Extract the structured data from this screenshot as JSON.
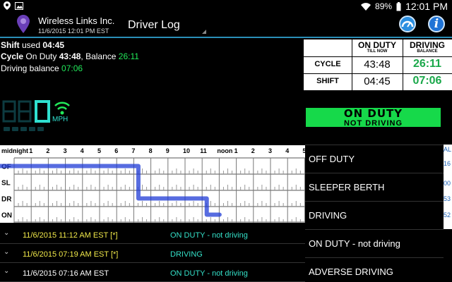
{
  "status_bar": {
    "battery": "89%",
    "time": "12:01 PM"
  },
  "header": {
    "company": "Wireless Links Inc.",
    "datetime": "11/6/2015 12:01 PM EST",
    "title": "Driver Log"
  },
  "summary": {
    "shift_label": "Shift",
    "shift_mid": " used ",
    "shift_used": "04:45",
    "cycle_label": "Cycle",
    "cycle_mid": " On Duty ",
    "cycle_on_duty": "43:48",
    "balance_label": ", Balance ",
    "cycle_balance": "26:11",
    "driving_label": "Driving balance ",
    "driving_balance": "07:06"
  },
  "hours_table": {
    "col1_title": "ON DUTY",
    "col1_sub": "TILL NOW",
    "col2_title": "DRIVING",
    "col2_sub": "BALANCE",
    "rows": [
      {
        "label": "CYCLE",
        "on_duty": "43:48",
        "driving": "26:11"
      },
      {
        "label": "SHIFT",
        "on_duty": "04:45",
        "driving": "07:06"
      }
    ]
  },
  "speedometer": {
    "value": "0",
    "unit": "MPH"
  },
  "duty_status": {
    "line1": "ON DUTY",
    "line2": "NOT DRIVING",
    "color": "#16d94a"
  },
  "chart_data": {
    "type": "line",
    "hour_labels": [
      "midnight",
      "1",
      "2",
      "3",
      "4",
      "5",
      "6",
      "7",
      "8",
      "9",
      "10",
      "11",
      "noon",
      "1",
      "2",
      "3",
      "4",
      "5"
    ],
    "rows": [
      "OF",
      "SL",
      "DR",
      "ON"
    ],
    "segments": [
      {
        "status": "OF",
        "start": 0,
        "end": 7.27
      },
      {
        "status": "DR",
        "start": 7.27,
        "end": 11.27
      },
      {
        "status": "ON",
        "start": 11.27,
        "end": 12.02
      }
    ],
    "line_color": "#1f3bd6"
  },
  "menu": {
    "items": [
      "OFF DUTY",
      "SLEEPER BERTH",
      "DRIVING",
      "ON DUTY - not driving",
      "ADVERSE DRIVING"
    ],
    "strip": [
      "AL",
      "16",
      "00",
      "53",
      "52"
    ]
  },
  "log_entries": [
    {
      "time": "11/6/2015 11:12 AM EST [*]",
      "status": "ON DUTY - not driving",
      "time_color": "#f1e94a",
      "status_color": "#34e0c8"
    },
    {
      "time": "11/6/2015 07:19 AM EST [*]",
      "status": "DRIVING",
      "time_color": "#f1e94a",
      "status_color": "#34e0c8"
    },
    {
      "time": "11/6/2015 07:16 AM EST",
      "status": "ON DUTY - not driving",
      "time_color": "#ffffff",
      "status_color": "#34e0c8"
    }
  ]
}
